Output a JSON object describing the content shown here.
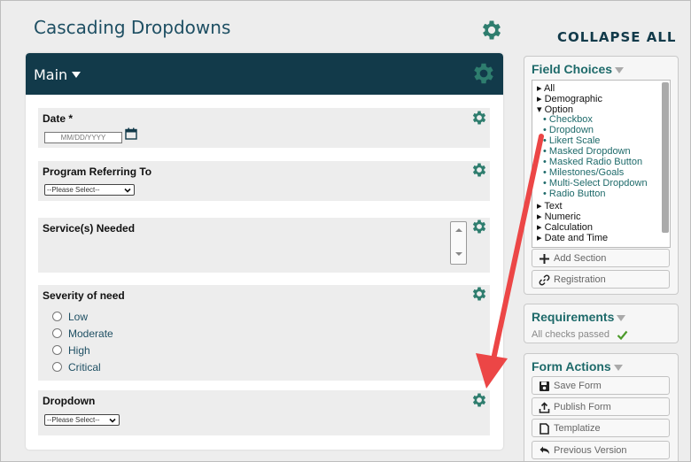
{
  "page": {
    "title": "Cascading Dropdowns",
    "collapse_all": "COLLAPSE ALL"
  },
  "main_section": {
    "title": "Main"
  },
  "fields": {
    "date": {
      "label": "Date *",
      "placeholder": "MM/DD/YYYY"
    },
    "program": {
      "label": "Program Referring To",
      "selected": "--Please Select--"
    },
    "services": {
      "label": "Service(s) Needed"
    },
    "severity": {
      "label": "Severity of need",
      "options": [
        "Low",
        "Moderate",
        "High",
        "Critical"
      ]
    },
    "dropdown": {
      "label": "Dropdown",
      "selected": "--Please Select--"
    }
  },
  "field_choices": {
    "title": "Field Choices",
    "items": [
      "▸ All",
      "▸ Demographic",
      "▾ Option",
      "• Checkbox",
      "• Dropdown",
      "• Likert Scale",
      "• Masked Dropdown",
      "• Masked Radio Button",
      "• Milestones/Goals",
      "• Multi-Select Dropdown",
      "• Radio Button",
      "▸ Text",
      "▸ Numeric",
      "▸ Calculation",
      "▸ Date and Time"
    ],
    "add_section": "Add Section",
    "registration": "Registration"
  },
  "requirements": {
    "title": "Requirements",
    "status": "All checks passed"
  },
  "form_actions": {
    "title": "Form Actions",
    "save": "Save Form",
    "publish": "Publish Form",
    "templatize": "Templatize",
    "previous": "Previous Version"
  },
  "colors": {
    "header_bg": "#123a4a",
    "gear": "#2e7d6e",
    "accent_text": "#1e6a6a",
    "arrow": "#ec4646"
  }
}
